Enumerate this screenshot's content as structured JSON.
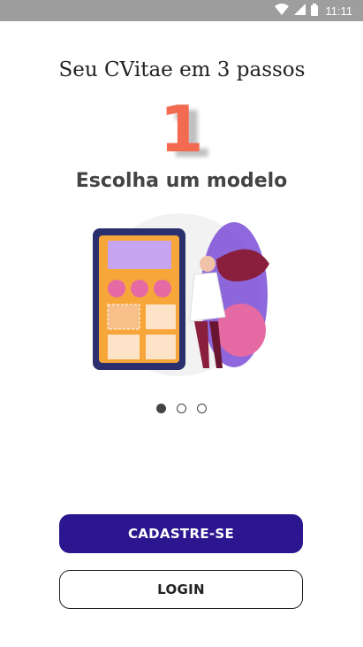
{
  "status_bar": {
    "time": "11:11",
    "icons": [
      "wifi-icon",
      "signal-icon",
      "battery-icon"
    ]
  },
  "onboarding": {
    "title": "Seu CVitae em 3 passos",
    "step_number": "1",
    "step_label": "Escolha um modelo",
    "pager": {
      "pages": 3,
      "active_index": 0
    }
  },
  "buttons": {
    "register": "CADASTRE-SE",
    "login": "LOGIN"
  },
  "colors": {
    "primary": "#2c168f",
    "accent": "#f26a4f"
  }
}
